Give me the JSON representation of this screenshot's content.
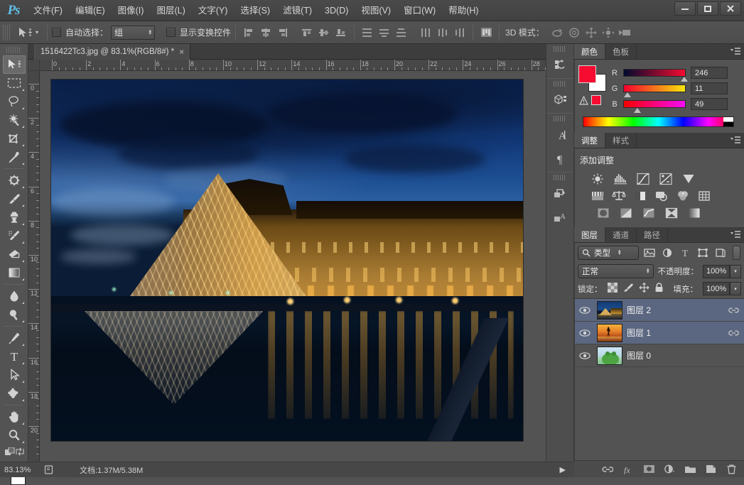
{
  "app": {
    "logo": "Ps"
  },
  "menu": {
    "items": [
      {
        "label": "文件(F)"
      },
      {
        "label": "编辑(E)"
      },
      {
        "label": "图像(I)"
      },
      {
        "label": "图层(L)"
      },
      {
        "label": "文字(Y)"
      },
      {
        "label": "选择(S)"
      },
      {
        "label": "滤镜(T)"
      },
      {
        "label": "3D(D)"
      },
      {
        "label": "视图(V)"
      },
      {
        "label": "窗口(W)"
      },
      {
        "label": "帮助(H)"
      }
    ],
    "window_controls": [
      {
        "name": "minimize",
        "glyph": "—"
      },
      {
        "name": "maximize",
        "glyph": "❐"
      },
      {
        "name": "close",
        "glyph": "✕"
      }
    ]
  },
  "options_bar": {
    "tool_icon": "move-tool-icon",
    "auto_select_label": "自动选择：",
    "auto_select_value": "组",
    "auto_select_checked": false,
    "show_transform_label": "显示变换控件",
    "show_transform_checked": false,
    "align_icons": [
      "align-left-edges-icon",
      "align-horizontal-centers-icon",
      "align-right-edges-icon",
      "align-top-edges-icon",
      "align-vertical-centers-icon",
      "align-bottom-edges-icon"
    ],
    "distribute_icons": [
      "distribute-top-icon",
      "distribute-vertical-center-icon",
      "distribute-bottom-icon",
      "distribute-left-icon",
      "distribute-horizontal-center-icon",
      "distribute-right-icon"
    ],
    "auto_align_icon": "auto-align-layers-icon",
    "mode_3d_label": "3D 模式：",
    "mode_3d_icons": [
      "rotate-3d-icon",
      "roll-3d-icon",
      "pan-3d-icon",
      "slide-3d-icon",
      "scale-3d-icon"
    ]
  },
  "document": {
    "tab_title": "1516422Tc3.jpg @ 83.1%(RGB/8#) *",
    "close_glyph": "×",
    "ruler_h_labels": [
      "0",
      "2",
      "4",
      "6",
      "8",
      "10",
      "12",
      "14",
      "16",
      "18",
      "20",
      "22",
      "24",
      "26",
      "28"
    ],
    "ruler_v_labels": [
      "0",
      "2",
      "4",
      "6",
      "8",
      "10",
      "12",
      "14",
      "16",
      "18",
      "20"
    ]
  },
  "toolbox": {
    "tools": [
      {
        "name": "move-tool",
        "selected": true,
        "menu": false
      },
      {
        "name": "rectangular-marquee-tool",
        "selected": false,
        "menu": true
      },
      {
        "name": "lasso-tool",
        "selected": false,
        "menu": true
      },
      {
        "name": "quick-selection-tool",
        "selected": false,
        "menu": true
      },
      {
        "name": "crop-tool",
        "selected": false,
        "menu": true
      },
      {
        "name": "eyedropper-tool",
        "selected": false,
        "menu": true
      },
      {
        "name": "spot-healing-brush-tool",
        "selected": false,
        "menu": true
      },
      {
        "name": "brush-tool",
        "selected": false,
        "menu": true
      },
      {
        "name": "clone-stamp-tool",
        "selected": false,
        "menu": true
      },
      {
        "name": "history-brush-tool",
        "selected": false,
        "menu": true
      },
      {
        "name": "eraser-tool",
        "selected": false,
        "menu": true
      },
      {
        "name": "gradient-tool",
        "selected": false,
        "menu": true
      },
      {
        "name": "blur-tool",
        "selected": false,
        "menu": true
      },
      {
        "name": "dodge-tool",
        "selected": false,
        "menu": true
      },
      {
        "name": "pen-tool",
        "selected": false,
        "menu": true
      },
      {
        "name": "horizontal-type-tool",
        "selected": false,
        "menu": true
      },
      {
        "name": "path-selection-tool",
        "selected": false,
        "menu": true
      },
      {
        "name": "custom-shape-tool",
        "selected": false,
        "menu": true
      },
      {
        "name": "hand-tool",
        "selected": false,
        "menu": true
      },
      {
        "name": "zoom-tool",
        "selected": false,
        "menu": true
      }
    ],
    "foreground_color": "#f60b31",
    "background_color": "#ffffff"
  },
  "dock_strip": {
    "items": [
      {
        "name": "history-panel-icon"
      },
      {
        "name": "3d-panel-icon"
      },
      {
        "name": "character-panel-icon"
      },
      {
        "name": "paragraph-panel-icon"
      },
      {
        "name": "layer-comps-panel-icon"
      },
      {
        "name": "character-styles-panel-icon"
      }
    ]
  },
  "color_panel": {
    "tabs": [
      {
        "label": "颜色",
        "active": true
      },
      {
        "label": "色板",
        "active": false
      }
    ],
    "foreground_color": "#f60b31",
    "background_color": "#ffffff",
    "channels": [
      {
        "label": "R",
        "value": "246",
        "gradient": "linear-gradient(to right,#000a2e,#f60b31)",
        "pos": 88
      },
      {
        "label": "G",
        "value": "11",
        "gradient": "linear-gradient(to right,#f6002f,#f6e60b)",
        "pos": 5
      },
      {
        "label": "B",
        "value": "49",
        "gradient": "linear-gradient(to right,#f60000,#f60bf6)",
        "pos": 19
      }
    ],
    "out_of_gamut_icon": "gamut-warning-icon",
    "out_of_gamut_color": "#f60b31"
  },
  "adjustments_panel": {
    "tabs": [
      {
        "label": "调整",
        "active": true
      },
      {
        "label": "样式",
        "active": false
      }
    ],
    "title": "添加调整",
    "rows": [
      [
        "brightness-contrast-icon",
        "levels-icon",
        "curves-icon",
        "exposure-icon",
        "vibrance-icon"
      ],
      [
        "hue-saturation-icon",
        "color-balance-icon",
        "black-white-icon",
        "photo-filter-icon",
        "channel-mixer-icon",
        "color-lookup-icon"
      ],
      [
        "invert-icon",
        "posterize-icon",
        "threshold-icon",
        "selective-color-icon",
        "gradient-map-icon"
      ]
    ]
  },
  "layers_panel": {
    "tabs": [
      {
        "label": "图层",
        "active": true
      },
      {
        "label": "通道",
        "active": false
      },
      {
        "label": "路径",
        "active": false
      }
    ],
    "filter": {
      "icon": "search-icon",
      "value": "类型",
      "type_icons": [
        "filter-pixel-icon",
        "filter-adjustment-icon",
        "filter-type-icon",
        "filter-shape-icon",
        "filter-smart-object-icon"
      ],
      "toggle_name": "filter-toggle-switch"
    },
    "blend_mode": "正常",
    "opacity_label": "不透明度：",
    "opacity_value": "100%",
    "lock_label": "锁定：",
    "lock_icons": [
      "lock-transparent-pixels-icon",
      "lock-image-pixels-icon",
      "lock-position-icon",
      "lock-all-icon"
    ],
    "fill_label": "填充：",
    "fill_value": "100%",
    "layers": [
      {
        "name": "图层 2",
        "selected": true,
        "visible": true,
        "linked": true,
        "thumb": "louvre"
      },
      {
        "name": "图层 1",
        "selected": true,
        "visible": true,
        "linked": true,
        "thumb": "sunset"
      },
      {
        "name": "图层 0",
        "selected": false,
        "visible": true,
        "linked": false,
        "thumb": "green"
      }
    ],
    "bottom_icons": [
      {
        "name": "link-layers-icon"
      },
      {
        "name": "layer-style-fx-icon"
      },
      {
        "name": "add-layer-mask-icon"
      },
      {
        "name": "new-adjustment-layer-icon"
      },
      {
        "name": "new-group-icon"
      },
      {
        "name": "new-layer-icon"
      },
      {
        "name": "delete-layer-icon"
      }
    ]
  },
  "status_bar": {
    "zoom": "83.13%",
    "doc_icon": "document-profile-icon",
    "doc_info": "文档:1.37M/5.38M",
    "arrow_glyph": "▶"
  }
}
